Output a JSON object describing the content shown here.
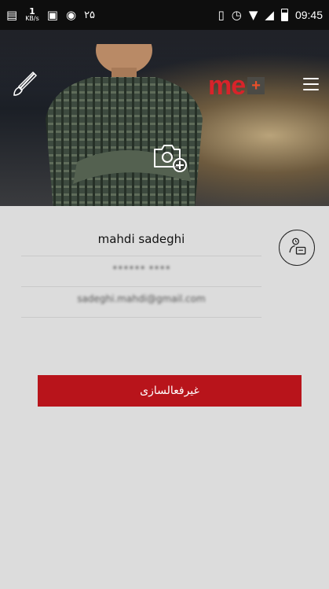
{
  "status_bar": {
    "speed_value": "1",
    "speed_unit": "KB/s",
    "notification_count": "۲۵",
    "time": "09:45"
  },
  "header": {
    "brand": "me",
    "brand_plus": "+"
  },
  "profile": {
    "name": "mahdi sadeghi",
    "phone_blurred": "•••••• ••••",
    "email_blurred": "sadeghi.mahdi@gmail.com"
  },
  "actions": {
    "deactivate_label": "غیرفعالسازی"
  },
  "colors": {
    "accent": "#b8141b",
    "background": "#dcdcdc",
    "brand": "#d8232a"
  }
}
